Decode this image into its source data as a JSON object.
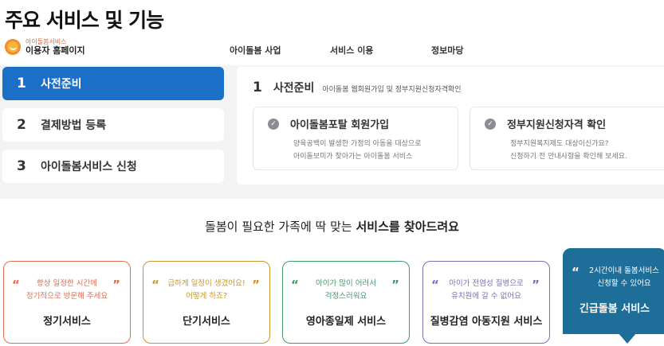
{
  "page_title": "주요 서비스 및 기능",
  "header": {
    "logo_line1": "아이돌봄서비스",
    "logo_line2": "이용자 홈페이지",
    "nav": [
      "아이돌봄 사업",
      "서비스 이용",
      "정보마당"
    ]
  },
  "steps": [
    {
      "num": "1",
      "label": "사전준비"
    },
    {
      "num": "2",
      "label": "결제방법 등록"
    },
    {
      "num": "3",
      "label": "아이돌봄서비스 신청"
    }
  ],
  "panel": {
    "num": "1",
    "title": "사전준비",
    "desc": "아이돌봄 웹회원가입 및 정부지원신청자격확인",
    "cards": [
      {
        "title": "아이돌봄포탈 회원가입",
        "line1": "양육공백이 발생한 가정의 아동을 대상으로",
        "line2": "아이돌보미가 찾아가는 아이돌봄 서비스"
      },
      {
        "title": "정부지원신청자격 확인",
        "line1": "정부지원복지제도 대상이신가요?",
        "line2": "신청하기 전 안내사항을 확인해 보세요."
      }
    ]
  },
  "headline": {
    "text": "돌봄이 필요한 가족에 딱 맞는 ",
    "bold": "서비스를 찾아드려요"
  },
  "services": [
    {
      "line1": "항상 일정한 시간에",
      "line2": "정기적으로 방문해 주세요",
      "name": "정기서비스",
      "color": "#e06d52"
    },
    {
      "line1": "급하게 일정이 생겼어요!",
      "line2": "어떻게 하죠?",
      "name": "단기서비스",
      "color": "#c9962d"
    },
    {
      "line1": "아이가 많이 어려서",
      "line2": "걱정스러워요",
      "name": "영아종일제 서비스",
      "color": "#3f9a6a"
    },
    {
      "line1": "아이가 전염성 질병으로",
      "line2": "유치원에 갈 수 없어요",
      "name": "질병감염 아동지원 서비스",
      "color": "#7a6fb3"
    },
    {
      "line1": "2시간이내 돌봄서비스",
      "line2": "신청할 수 있어요",
      "name": "긴급돌봄 서비스",
      "color": "#1d6e99"
    }
  ],
  "quote_open": "“",
  "quote_close": "”",
  "check_glyph": "✓"
}
